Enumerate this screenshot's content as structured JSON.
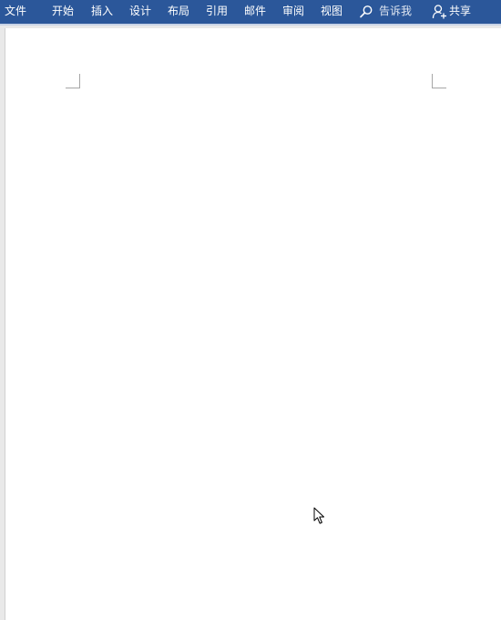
{
  "ribbon": {
    "tabs": [
      {
        "id": "file",
        "label": "文件"
      },
      {
        "id": "home",
        "label": "开始"
      },
      {
        "id": "insert",
        "label": "插入"
      },
      {
        "id": "design",
        "label": "设计"
      },
      {
        "id": "layout",
        "label": "布局"
      },
      {
        "id": "references",
        "label": "引用"
      },
      {
        "id": "mailings",
        "label": "邮件"
      },
      {
        "id": "review",
        "label": "审阅"
      },
      {
        "id": "view",
        "label": "视图"
      }
    ],
    "tell_me": {
      "label": "告诉我",
      "icon": "search-icon"
    },
    "share": {
      "label": "共享",
      "icon": "person-add-icon"
    }
  },
  "colors": {
    "ribbon_bg": "#2b579a",
    "ribbon_text": "#ffffff",
    "canvas_bg": "#e9e9e9",
    "page_bg": "#ffffff"
  },
  "cursor": {
    "icon": "mouse-pointer-icon"
  }
}
